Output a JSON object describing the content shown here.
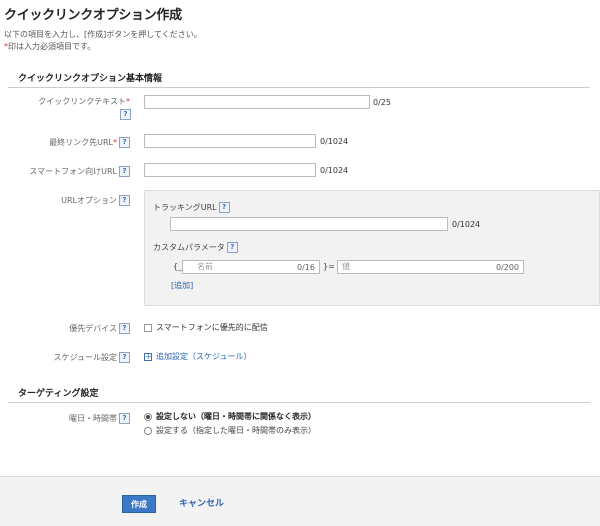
{
  "page": {
    "title": "クイックリンクオプション作成",
    "intro_line1": "以下の項目を入力し、[作成]ボタンを押してください。",
    "intro_required_mark": "*",
    "intro_line2": "印は入力必須項目です。"
  },
  "basic_section": {
    "heading": "クイックリンクオプション基本情報",
    "quicklink_text": {
      "label": "クイックリンクテキスト",
      "required_mark": "*",
      "value": "",
      "counter": "0/25"
    },
    "final_url": {
      "label": "最終リンク先URL",
      "required_mark": "*",
      "value": "",
      "counter": "0/1024"
    },
    "smartphone_url": {
      "label": "スマートフォン向けURL",
      "value": "",
      "counter": "0/1024"
    },
    "url_options": {
      "label": "URLオプション",
      "tracking_label": "トラッキングURL",
      "tracking_counter": "0/1024",
      "custom_param_label": "カスタムパラメータ",
      "brace_open": "{_",
      "name_placeholder": "名前",
      "name_counter": "0/16",
      "equals": "}=",
      "value_placeholder": "値",
      "value_counter": "0/200",
      "add_link": "[追加]"
    },
    "preferred_device": {
      "label": "優先デバイス",
      "checkbox_label": "スマートフォンに優先的に配信"
    },
    "schedule": {
      "label": "スケジュール設定",
      "add_link": "追加設定（スケジュール）"
    }
  },
  "targeting_section": {
    "heading": "ターゲティング設定",
    "day_time": {
      "label": "曜日・時間帯",
      "option_off": "設定しない（曜日・時間帯に関係なく表示）",
      "option_on": "設定する（指定した曜日・時間帯のみ表示）"
    }
  },
  "footer": {
    "create_button": "作成",
    "cancel_button": "キャンセル"
  },
  "help_icon_glyph": "?"
}
